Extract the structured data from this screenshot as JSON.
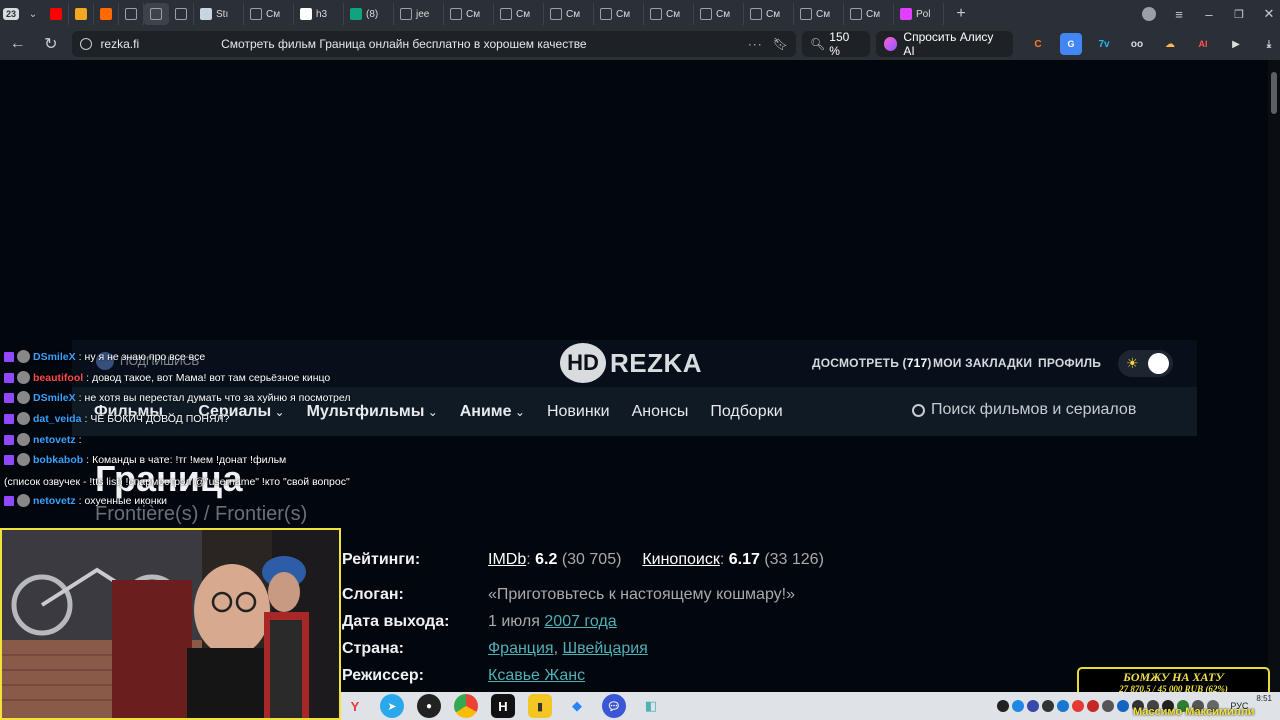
{
  "browser": {
    "tab_count": "23",
    "tabs": [
      {
        "label": "",
        "icon": "youtube-icon",
        "color": "#ff0000"
      },
      {
        "label": "",
        "icon": "m-icon",
        "color": "#f5a623"
      },
      {
        "label": "",
        "icon": "fire-icon",
        "color": "#ff6a00"
      },
      {
        "label": "",
        "icon": "hd-icon",
        "color": "#9aa0a6"
      },
      {
        "label": "",
        "icon": "hd-icon",
        "color": "#9aa0a6"
      },
      {
        "label": "",
        "icon": "hd-icon",
        "color": "#9aa0a6"
      },
      {
        "label": "Stı",
        "icon": "steam-icon",
        "color": "#c7d5e0"
      },
      {
        "label": "См",
        "icon": "hd-icon",
        "color": "#9aa0a6"
      },
      {
        "label": "h3",
        "icon": "new-icon",
        "color": "#ffffff"
      },
      {
        "label": "(8)",
        "icon": "g-icon",
        "color": "#10a37f"
      },
      {
        "label": "jee",
        "icon": "hd-icon",
        "color": "#9aa0a6"
      },
      {
        "label": "См",
        "icon": "hd-icon",
        "color": "#9aa0a6"
      },
      {
        "label": "См",
        "icon": "hd-icon",
        "color": "#9aa0a6"
      },
      {
        "label": "См",
        "icon": "hd-icon",
        "color": "#9aa0a6"
      },
      {
        "label": "См",
        "icon": "hd-icon",
        "color": "#9aa0a6"
      },
      {
        "label": "См",
        "icon": "hd-icon",
        "color": "#9aa0a6"
      },
      {
        "label": "См",
        "icon": "hd-icon",
        "color": "#9aa0a6"
      },
      {
        "label": "См",
        "icon": "hd-icon",
        "color": "#9aa0a6"
      },
      {
        "label": "См",
        "icon": "hd-icon",
        "color": "#9aa0a6"
      },
      {
        "label": "См",
        "icon": "hd-icon",
        "color": "#9aa0a6"
      },
      {
        "label": "Pol",
        "icon": "palette-icon",
        "color": "#e040fb"
      }
    ],
    "domain": "rezka.fi",
    "page_title": "Смотреть фильм Граница онлайн бесплатно в хорошем качестве",
    "zoom": "150 %",
    "alice_label": "Спросить Алису AI"
  },
  "site": {
    "logo_hd": "HD",
    "logo_text": "REZKA",
    "watch_label": "ДОСМОТРЕТЬ",
    "watch_count": "717",
    "bookmarks": "МОИ ЗАКЛАДКИ",
    "profile": "ПРОФИЛЬ",
    "nav": [
      {
        "label": "Фильмы",
        "bold": true,
        "dropdown": true
      },
      {
        "label": "Сериалы",
        "bold": true,
        "dropdown": true
      },
      {
        "label": "Мультфильмы",
        "bold": true,
        "dropdown": true
      },
      {
        "label": "Аниме",
        "bold": true,
        "dropdown": true
      },
      {
        "label": "Новинки",
        "bold": false,
        "dropdown": false
      },
      {
        "label": "Анонсы",
        "bold": false,
        "dropdown": false
      },
      {
        "label": "Подборки",
        "bold": false,
        "dropdown": false
      }
    ],
    "search_placeholder": "Поиск фильмов и сериалов",
    "subscribe": "ПОДПИШИСЬ"
  },
  "movie": {
    "title": "Граница",
    "original_title": "Frontière(s) / Frontier(s)",
    "ratings_label": "Рейтинги:",
    "imdb_label": "IMDb",
    "imdb_score": "6.2",
    "imdb_votes": "(30 705)",
    "kp_label": "Кинопоиск",
    "kp_score": "6.17",
    "kp_votes": "(33 126)",
    "slogan_label": "Слоган:",
    "slogan": "«Приготовьтесь к настоящему кошмару!»",
    "release_label": "Дата выхода:",
    "release_day": "1 июля",
    "release_year": "2007 года",
    "country_label": "Страна:",
    "country_1": "Франция",
    "country_2": "Швейцария",
    "director_label": "Режиссер:",
    "director": "Ксавье Жанс"
  },
  "chat": [
    {
      "nick": "DSmileX",
      "text": "ну я не знаю про все все",
      "nick_color": "#38a2ff"
    },
    {
      "nick": "beautifool",
      "text": "довод такое, вот Мама! вот там серьёзное кинцо",
      "nick_color": "#ff4b4b"
    },
    {
      "nick": "DSmileX",
      "text": "не хотя вы перестал думать что за хуйню я посмотрел",
      "nick_color": "#38a2ff"
    },
    {
      "nick": "dat_veida",
      "text": "ЧЕ БОКИЧ ДОВОД ПОНЯЛ?",
      "nick_color": "#38a2ff"
    },
    {
      "nick": "netovetz",
      "text": "",
      "nick_color": "#38a2ff"
    },
    {
      "nick": "bobkabob",
      "text": "Команды в чате: !тг !мем !донат !фильм",
      "nick_color": "#38a2ff"
    },
    {
      "nick": "",
      "text": "(список озвучек - !tts list) !спармострэл @\"username\" !кто \"свой вопрос\"",
      "nick_color": "#38a2ff"
    },
    {
      "nick": "netovetz",
      "text": "охуенные иконки",
      "nick_color": "#38a2ff"
    }
  ],
  "donation": {
    "title": "БОМЖУ НА ХАТУ",
    "amount": "27 870.5 / 45 000 RUB (62%)",
    "progress": 0.62
  },
  "donor_name": "Массимо Максимилли",
  "taskbar": {
    "lang": "РУС",
    "time": "8:51"
  }
}
